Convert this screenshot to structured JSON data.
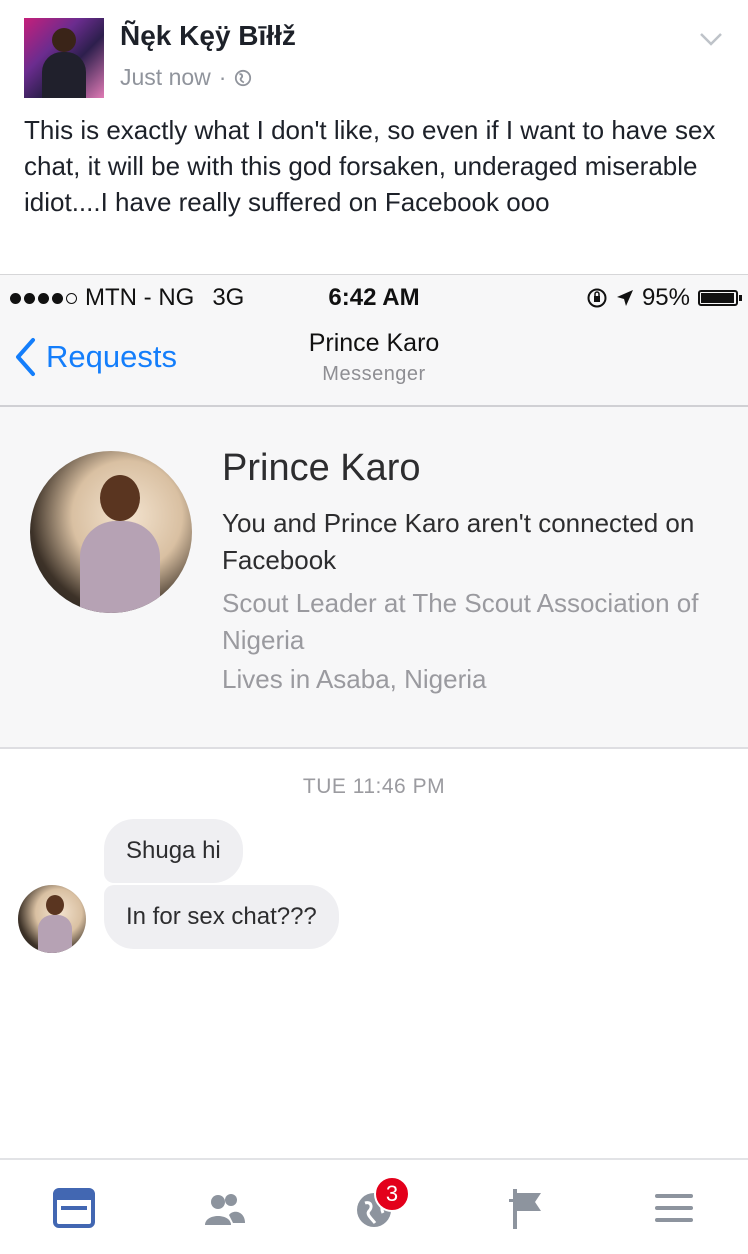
{
  "post": {
    "author": "Ñęk Kęÿ Bīłłž",
    "time": "Just now",
    "separator": "·",
    "text": "This is exactly what I don't like, so even if I want to have sex chat, it will be with this god forsaken, underaged miserable idiot....I have really suffered on Facebook ooo"
  },
  "screenshot": {
    "status_bar": {
      "carrier": "MTN - NG",
      "network": "3G",
      "time": "6:42 AM",
      "battery": "95%"
    },
    "nav": {
      "back_label": "Requests",
      "title": "Prince Karo",
      "subtitle": "Messenger"
    },
    "profile": {
      "name": "Prince Karo",
      "connection": "You and Prince Karo aren't connected on Facebook",
      "work": "Scout Leader at The Scout Association of Nigeria",
      "lives": "Lives in Asaba, Nigeria"
    },
    "chat": {
      "timestamp": "TUE 11:46 PM",
      "messages": [
        {
          "text": "Shuga hi"
        },
        {
          "text": "In for sex chat???"
        }
      ]
    }
  },
  "tabbar": {
    "tabs": [
      {
        "icon": "news-feed-icon"
      },
      {
        "icon": "friends-icon"
      },
      {
        "icon": "notifications-globe-icon",
        "badge": "3"
      },
      {
        "icon": "pages-flag-icon"
      },
      {
        "icon": "menu-icon"
      }
    ],
    "accent": "#4267b2",
    "inactive": "#8d949e",
    "badge_color": "#e3001b"
  }
}
